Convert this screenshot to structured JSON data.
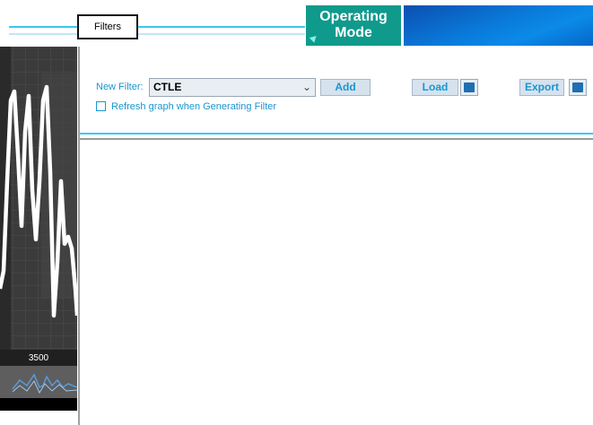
{
  "header": {
    "tab_filters": "Filters",
    "operating_mode_line1": "Operating",
    "operating_mode_line2": "Mode"
  },
  "left_panel": {
    "frequency_label": "3500"
  },
  "filter_panel": {
    "new_filter_label": "New Filter:",
    "selected_filter": "CTLE",
    "add_label": "Add",
    "load_label": "Load",
    "export_label": "Export",
    "refresh_checkbox_label": "Refresh graph when Generating Filter",
    "refresh_checked": false
  },
  "colors": {
    "accent_cyan": "#3cc8f0",
    "operating_mode_bg": "#0f9a8c",
    "link_blue": "#1a96d0"
  },
  "icons": [
    "folder-open-icon",
    "save-disk-icon",
    "chevron-down-icon",
    "play-arrow-icon"
  ]
}
